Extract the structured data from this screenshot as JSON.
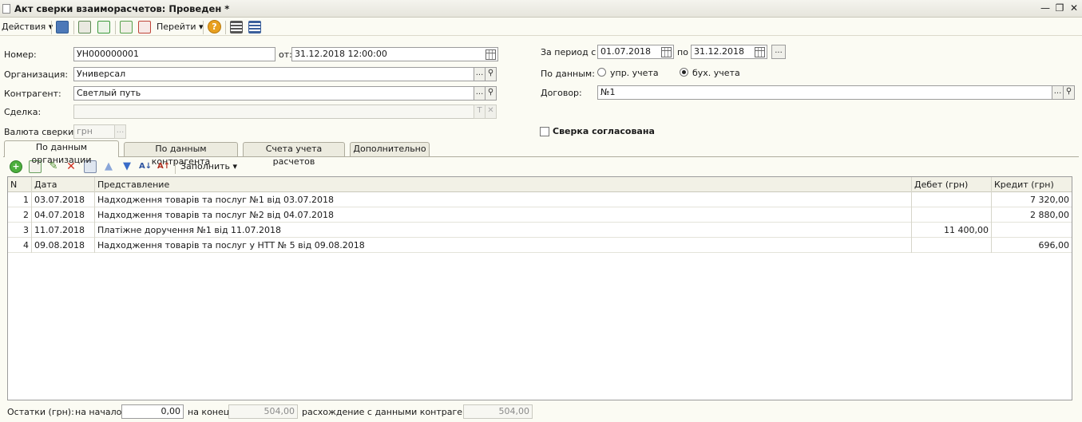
{
  "window": {
    "title": "Акт сверки взаиморасчетов: Проведен *"
  },
  "toolbar": {
    "actions_label": "Действия",
    "goto_label": "Перейти"
  },
  "form": {
    "number_label": "Номер:",
    "number_value": "УН000000001",
    "date_from_label": "от:",
    "date_value": "31.12.2018 12:00:00",
    "org_label": "Организация:",
    "org_value": "Универсал",
    "counterparty_label": "Контрагент:",
    "counterparty_value": "Светлый путь",
    "deal_label": "Сделка:",
    "deal_value": "",
    "currency_label": "Валюта сверки:",
    "currency_value": "грн",
    "period_label": "За период с",
    "period_from": "01.07.2018",
    "period_to_label": "по",
    "period_to": "31.12.2018",
    "by_data_label": "По данным:",
    "radio_mgmt": "упр. учета",
    "radio_acc": "бух. учета",
    "contract_label": "Договор:",
    "contract_value": "№1",
    "agreed_label": "Сверка согласована"
  },
  "tabs": [
    {
      "label": "По данным организации"
    },
    {
      "label": "По данным контрагента"
    },
    {
      "label": "Счета учета расчетов"
    },
    {
      "label": "Дополнительно"
    }
  ],
  "table_toolbar": {
    "fill_label": "Заполнить"
  },
  "table": {
    "headers": {
      "n": "N",
      "date": "Дата",
      "repr": "Представление",
      "debit": "Дебет (грн)",
      "credit": "Кредит (грн)"
    },
    "rows": [
      {
        "n": "1",
        "date": "03.07.2018",
        "repr": "Надходження товарів та послуг  №1 від 03.07.2018",
        "debit": "",
        "credit": "7 320,00"
      },
      {
        "n": "2",
        "date": "04.07.2018",
        "repr": "Надходження товарів та послуг №2  від 04.07.2018",
        "debit": "",
        "credit": "2 880,00"
      },
      {
        "n": "3",
        "date": "11.07.2018",
        "repr": "Платіжне доручення  №1 від 11.07.2018",
        "debit": "11 400,00",
        "credit": ""
      },
      {
        "n": "4",
        "date": "09.08.2018",
        "repr": "Надходження товарів та послуг у НТТ № 5 від 09.08.2018",
        "debit": "",
        "credit": "696,00"
      }
    ]
  },
  "footer": {
    "balances_label": "Остатки (грн):",
    "start_label": "на начало:",
    "start_value": "0,00",
    "end_label": "на конец:",
    "end_value": "504,00",
    "diff_label": "расхождение с данными контрагента:",
    "diff_value": "504,00"
  },
  "colors": {
    "background": "#fbfbf3",
    "accent_help": "#e8a020"
  }
}
